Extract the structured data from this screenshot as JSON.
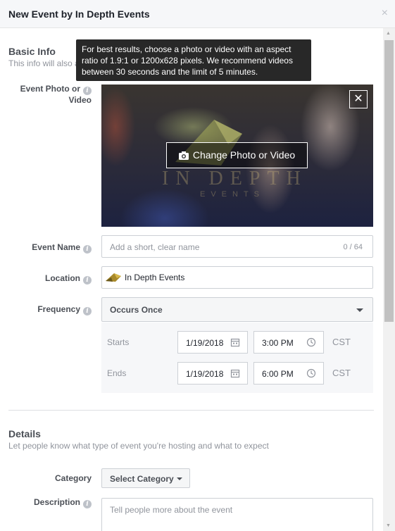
{
  "dialog": {
    "title": "New Event by In Depth Events",
    "close_symbol": "×"
  },
  "basic_info": {
    "title": "Basic Info",
    "subtitle_visible": "This info will also a"
  },
  "tooltip": {
    "text": "For best results, choose a photo or video with an aspect ratio of 1.9:1 or 1200x628 pixels. We recommend videos between 30 seconds and the limit of 5 minutes."
  },
  "photo": {
    "label_line1": "Event Photo or",
    "label_line2": "Video",
    "change_label": "Change Photo or Video",
    "remove_symbol": "✕",
    "watermark": "IN DEPTH",
    "watermark_sub": "EVENTS"
  },
  "event_name": {
    "label": "Event Name",
    "placeholder": "Add a short, clear name",
    "counter": "0 / 64"
  },
  "location": {
    "label": "Location",
    "value": "In Depth Events"
  },
  "frequency": {
    "label": "Frequency",
    "value": "Occurs Once"
  },
  "schedule": {
    "starts_label": "Starts",
    "start_date": "1/19/2018",
    "start_time": "3:00 PM",
    "start_tz": "CST",
    "ends_label": "Ends",
    "end_date": "1/19/2018",
    "end_time": "6:00 PM",
    "end_tz": "CST"
  },
  "details": {
    "title": "Details",
    "subtitle": "Let people know what type of event you're hosting and what to expect"
  },
  "category": {
    "label": "Category",
    "value": "Select Category"
  },
  "description": {
    "label": "Description",
    "placeholder": "Tell people more about the event"
  },
  "info_glyph": "i",
  "colors": {
    "header_bg": "#f6f7f9",
    "tooltip_bg": "#282828",
    "label": "#4b4f56",
    "muted": "#90949c"
  }
}
